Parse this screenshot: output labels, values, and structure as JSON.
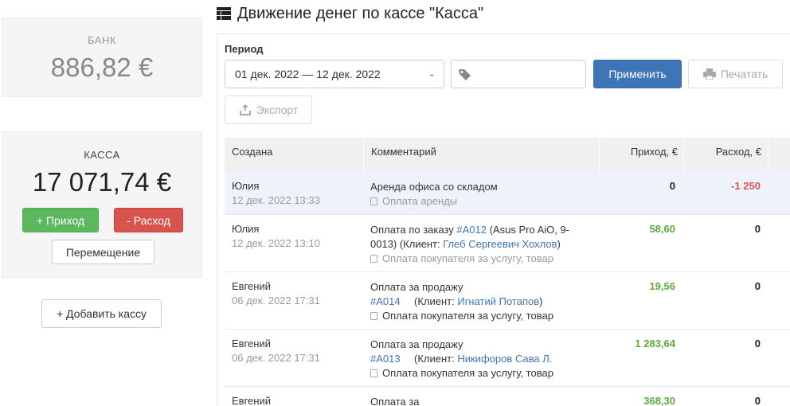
{
  "bank": {
    "title": "БАНК",
    "amount": "886,82 €"
  },
  "kassa": {
    "title": "КАССА",
    "amount": "17 071,74 €",
    "income_btn": "+ Приход",
    "expense_btn": "- Расход",
    "move_btn": "Перемещение"
  },
  "add_kassa_btn": "+ Добавить кассу",
  "header": {
    "title": "Движение денег по кассе \"Касса\"",
    "icon": "table-icon"
  },
  "filters": {
    "period_label": "Период",
    "period_value": "01 дек. 2022 — 12 дек. 2022",
    "apply_btn": "Применить",
    "print_btn": "Печатать",
    "export_btn": "Экспорт"
  },
  "table": {
    "headers": {
      "created": "Создана",
      "comment": "Комментарий",
      "income": "Приход, €",
      "expense": "Расход, €"
    },
    "rows": [
      {
        "user": "Юлия",
        "date": "12 дек. 2022 13:33",
        "comment_pre": "Аренда офиса со складом",
        "order": "",
        "mid": "",
        "client": "",
        "post": "",
        "category": "Оплата аренды",
        "income": "0",
        "expense": "-1 250"
      },
      {
        "user": "Юлия",
        "date": "12 дек. 2022 13:10",
        "comment_pre": "Оплата по заказу ",
        "order": "#A012",
        "mid": " (Asus Pro AiO, 9-0013) (Клиент: ",
        "client": "Глеб Сергеевич Хохлов",
        "post": ")",
        "category": "Оплата покупателя за услугу, товар",
        "income": "58,60",
        "expense": "0"
      },
      {
        "user": "Евгений",
        "date": "06 дек. 2022 17:31",
        "comment_pre": "Оплата за продажу ",
        "order": "#A014",
        "mid": " (Клиент: ",
        "client": "Игнатий Потапов",
        "post": ")",
        "category": "Оплата покупателя за услугу, товар",
        "income": "19,56",
        "expense": "0"
      },
      {
        "user": "Евгений",
        "date": "06 дек. 2022 17:31",
        "comment_pre": "Оплата за продажу ",
        "order": "#A013",
        "mid": " (Клиент: ",
        "client": "Никифоров Сава Л.",
        "post": "",
        "category": "Оплата покупателя за услугу, товар",
        "income": "1 283,64",
        "expense": "0"
      },
      {
        "user": "Евгений",
        "date": "",
        "comment_pre": "Оплата за",
        "order": "",
        "mid": "",
        "client": "",
        "post": "",
        "category": "",
        "income": "368,30",
        "expense": "0"
      }
    ]
  },
  "colors": {
    "income_green": "#5aaa3c",
    "expense_red": "#d9534f",
    "primary_blue": "#3f75b7",
    "link_blue": "#3f75b7"
  }
}
